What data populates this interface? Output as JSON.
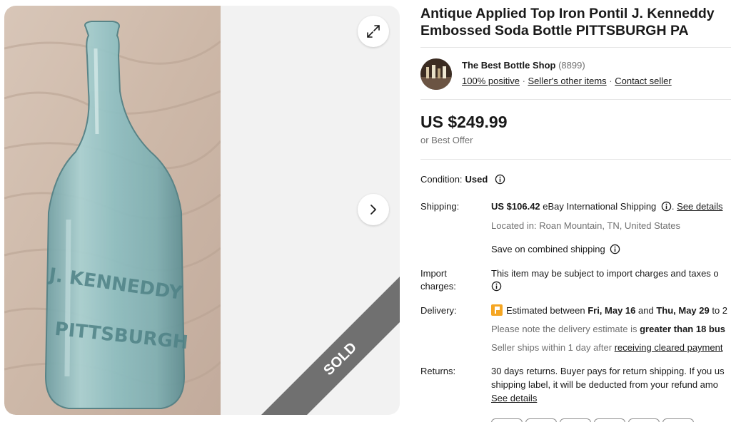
{
  "listing": {
    "title_line1": "Antique Applied Top Iron Pontil J. Kenneddy",
    "title_line2": "Embossed Soda Bottle PITTSBURGH PA",
    "sold_label": "SOLD"
  },
  "gallery": {
    "embossed_text": [
      "J. KENNEDDY",
      "PITTSBURGH"
    ],
    "expand_icon": "expand-icon",
    "next_icon": "chevron-right-icon"
  },
  "seller": {
    "name": "The Best Bottle Shop",
    "feedback_count": "(8899)",
    "positive": "100% positive",
    "other_items": "Seller's other items",
    "contact": "Contact seller",
    "separator": " · "
  },
  "price": {
    "amount": "US $249.99",
    "best_offer": "or Best Offer"
  },
  "condition": {
    "label": "Condition:",
    "value": "Used"
  },
  "shipping": {
    "label": "Shipping:",
    "cost": "US $106.42",
    "method": " eBay International Shipping",
    "see_details": "See details",
    "located_label": "Located in:",
    "located_value": " Roan Mountain, TN, United States",
    "combined": "Save on combined shipping"
  },
  "import": {
    "label_line1": "Import",
    "label_line2": "charges:",
    "text": "This item may be subject to import charges and taxes o"
  },
  "delivery": {
    "label": "Delivery:",
    "estimated": "Estimated between ",
    "date_start": "Fri, May 16",
    "and": " and ",
    "date_end": "Thu, May 29",
    "to": " to 2",
    "note_prefix": "Please note the delivery estimate is ",
    "note_bold": "greater than 18 bus",
    "handling_prefix": "Seller ships within 1 day after ",
    "handling_link": "receiving cleared payment"
  },
  "returns": {
    "label": "Returns:",
    "line1": "30 days returns. Buyer pays for return shipping. If you us",
    "line2": "shipping label, it will be deducted from your refund amo",
    "see_details": "See details"
  },
  "colors": {
    "text": "#191919",
    "muted": "#707070",
    "gallery_bg": "#f2f2f2",
    "sold_ribbon": "#707070",
    "delivery_flag": "#f5a623"
  }
}
